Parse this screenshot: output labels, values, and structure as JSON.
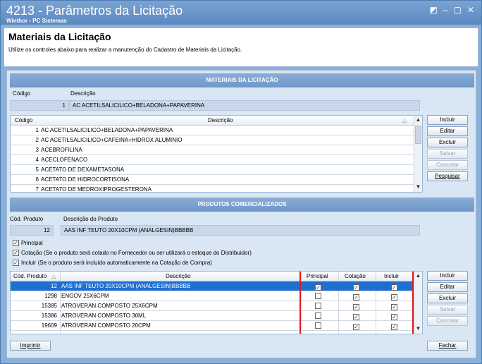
{
  "window": {
    "title": "4213 - Parâmetros da Licitação",
    "subtitle": "Winthor - PC Sistemas",
    "controls": [
      "◩",
      "–",
      "▢",
      "✕"
    ]
  },
  "header": {
    "title": "Materiais da Licitação",
    "description": "Utilize os controles abaixo para realizar a manutenção do Cadastro de Materiais da Licitação."
  },
  "materials": {
    "section_title": "MATERIAIS DA LICITAÇÃO",
    "codigo_label": "Código",
    "descricao_label": "Descrição",
    "codigo_value": "1",
    "descricao_value": "AC ACETILSALICILICO+BELADONA+PAPAVERINA",
    "grid": {
      "headers": [
        "Código",
        "Descrição"
      ],
      "sort_icon": "△",
      "rows": [
        {
          "code": "1",
          "desc": "AC ACETILSALICILICO+BELADONA+PAPAVERINA"
        },
        {
          "code": "2",
          "desc": "AC ACETILSALICILICO+CAFEINA+HIDROX ALUMINIO"
        },
        {
          "code": "3",
          "desc": "ACEBROFILINA"
        },
        {
          "code": "4",
          "desc": "ACECLOFENACO"
        },
        {
          "code": "5",
          "desc": "ACETATO DE DEXAMETASONA"
        },
        {
          "code": "6",
          "desc": "ACETATO DE HIDROCORTISONA"
        },
        {
          "code": "7",
          "desc": "ACETATO DE MEDROXIPROGESTERONA"
        }
      ]
    },
    "buttons": {
      "incluir": "Incluir",
      "editar": "Editar",
      "excluir": "Excluir",
      "salvar": "Salvar",
      "cancelar": "Cancelar",
      "pesquisar": "Pesquisar"
    }
  },
  "products": {
    "section_title": "PRODUTOS COMERCIALIZADOS",
    "cod_label": "Cód. Produto",
    "desc_label": "Descrição do Produto",
    "cod_value": "12",
    "desc_value": "AAS INF TEUTO 20X10CPM (ANALGESIN)BBBBB",
    "checks": {
      "principal": "Principal",
      "cotacao": "Cotação (Se o produto será cotado no Fornecedor ou ser utilizará o estoque do Distribuidor)",
      "incluir": "Incluir    (Se o produto será incluído automaticamente na Cotação de Compra)"
    },
    "grid": {
      "headers": [
        "Cód. Produto",
        "Descrição",
        "Principal",
        "Cotação",
        "Incluir"
      ],
      "sort_icon": "△",
      "rows": [
        {
          "code": "12",
          "desc": "AAS INF TEUTO 20X10CPM (ANALGESIN)BBBBB",
          "principal": true,
          "cotacao": true,
          "incluir": true
        },
        {
          "code": "1298",
          "desc": "ENGOV 25X6CPM",
          "principal": false,
          "cotacao": true,
          "incluir": true
        },
        {
          "code": "15385",
          "desc": "ATROVERAN COMPOSTO 25X6CPM",
          "principal": false,
          "cotacao": true,
          "incluir": true
        },
        {
          "code": "15386",
          "desc": "ATROVERAN COMPOSTO 30ML",
          "principal": false,
          "cotacao": true,
          "incluir": true
        },
        {
          "code": "19609",
          "desc": "ATROVERAN COMPOSTO 20CPM",
          "principal": false,
          "cotacao": true,
          "incluir": true
        }
      ]
    },
    "buttons": {
      "incluir": "Incluir",
      "editar": "Editar",
      "excluir": "Excluir",
      "salvar": "Salvar",
      "cancelar": "Cancelar"
    }
  },
  "footer": {
    "imprimir": "Imprimir",
    "fechar": "Fechar"
  },
  "colors": {
    "highlight": "#e01b1b",
    "selection": "#1f6fd1"
  }
}
